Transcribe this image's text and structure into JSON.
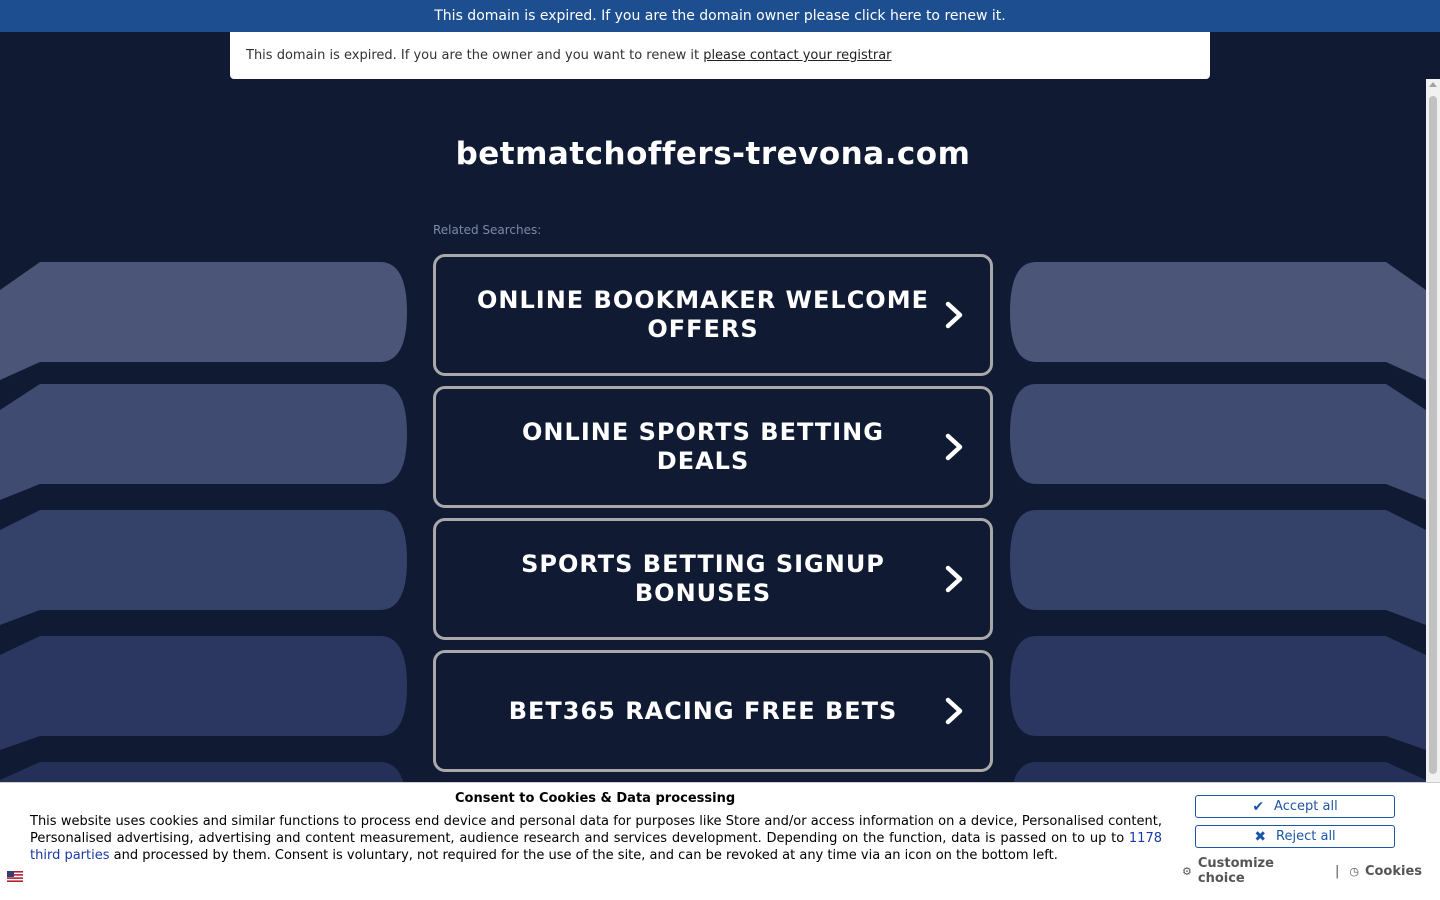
{
  "banner": {
    "text": "This domain is expired. If you are the domain owner please click here to renew it."
  },
  "notice": {
    "text": "This domain is expired. If you are the owner and you want to renew it ",
    "link": "please contact your registrar"
  },
  "domain": "betmatchoffers-trevona.com",
  "related": {
    "label": "Related Searches:",
    "items": [
      {
        "label": "ONLINE BOOKMAKER WELCOME OFFERS"
      },
      {
        "label": "ONLINE SPORTS BETTING DEALS"
      },
      {
        "label": "SPORTS BETTING SIGNUP BONUSES"
      },
      {
        "label": "BET365 RACING FREE BETS"
      }
    ]
  },
  "consent": {
    "title": "Consent to Cookies & Data processing",
    "text_before": "This website uses cookies and similar functions to process end device and personal data for purposes like Store and/or access information on a device, Personalised content, Personalised advertising, advertising and content measurement, audience research and services development. Depending on the function, data is passed on to up to ",
    "third_parties_link": "1178 third parties",
    "text_after": " and processed by them. Consent is voluntary, not required for the use of the site, and can be revoked at any time via an icon on the bottom left.",
    "accept_label": "Accept all",
    "reject_label": "Reject all",
    "customize_label": "Customize choice",
    "separator": "|",
    "cookies_label": "Cookies"
  },
  "icons": {
    "chevron": "chevron-right-icon",
    "accept": "check-icon",
    "reject": "x-icon",
    "customize": "gear-icon",
    "cookies": "cookie-icon",
    "flag": "us-flag-icon"
  },
  "colors": {
    "background": "#101a33",
    "banner": "#1d4e8f",
    "button_border": "#a9a9a9",
    "consent_accent": "#1c56a6"
  }
}
